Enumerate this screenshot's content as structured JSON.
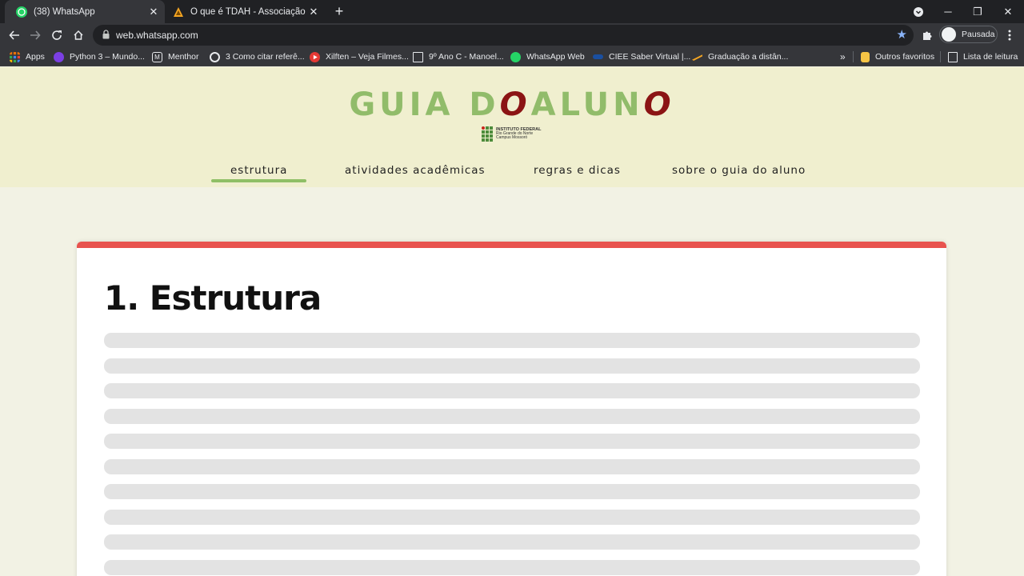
{
  "browser": {
    "tabs": [
      {
        "title": "(38) WhatsApp",
        "active": true
      },
      {
        "title": "O que é TDAH - Associação Brasi",
        "active": false
      }
    ],
    "url": "web.whatsapp.com",
    "profile_label": "Pausada",
    "bookmarks": [
      {
        "label": "Apps",
        "icon": "apps-grid-icon",
        "color": "#e8710a"
      },
      {
        "label": "Python 3 – Mundo...",
        "icon": "python-icon",
        "color": "#7b3fe4"
      },
      {
        "label": "Menthor",
        "icon": "menthor-icon",
        "color": "#e8eaed"
      },
      {
        "label": "3 Como citar referê...",
        "icon": "globe-icon",
        "color": "#e8eaed"
      },
      {
        "label": "Xilften – Veja Filmes...",
        "icon": "play-icon",
        "color": "#e53935"
      },
      {
        "label": "9º Ano C - Manoel...",
        "icon": "classroom-icon",
        "color": "#e8eaed"
      },
      {
        "label": "WhatsApp Web",
        "icon": "whatsapp-icon",
        "color": "#25d366"
      },
      {
        "label": "CIEE Saber Virtual |...",
        "icon": "ciee-icon",
        "color": "#1a4fa0"
      },
      {
        "label": "Graduação a distân...",
        "icon": "graduation-icon",
        "color": "#f5a623"
      }
    ],
    "overflow_label": "»",
    "other_bookmarks": "Outros favoritos",
    "reading_list": "Lista de leitura"
  },
  "site": {
    "logo_parts": [
      "GUIA D",
      "O",
      "ALUN",
      "O"
    ],
    "institution": {
      "line1": "INSTITUTO FEDERAL",
      "line2": "Rio Grande do Norte",
      "line3": "Campus Mossoró"
    },
    "nav": [
      {
        "label": "estrutura",
        "active": true
      },
      {
        "label": "atividades acadêmicas",
        "active": false
      },
      {
        "label": "regras e dicas",
        "active": false
      },
      {
        "label": "sobre o guia do aluno",
        "active": false
      }
    ],
    "section_title": "1. Estrutura",
    "placeholder_lines": 10,
    "colors": {
      "header_bg": "#f0efcf",
      "logo_green": "#91bc6a",
      "logo_red": "#8b1414",
      "card_accent": "#e8534e",
      "nav_underline": "#8fbf66"
    }
  }
}
